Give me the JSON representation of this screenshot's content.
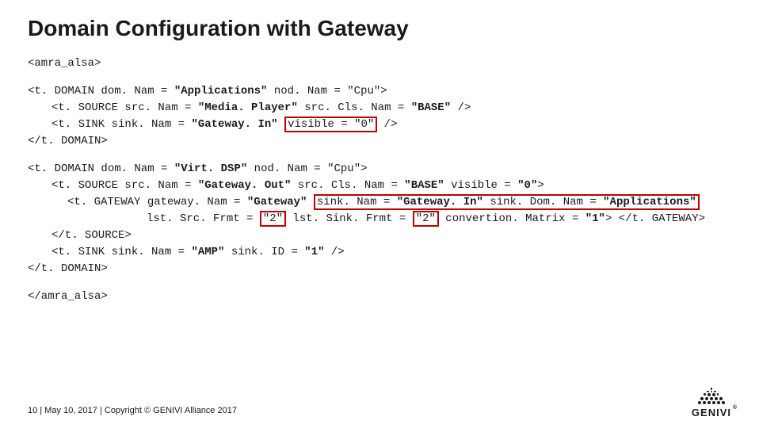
{
  "title": "Domain Configuration with Gateway",
  "code": {
    "open_tag": "<amra_alsa>",
    "block1": {
      "line1_pre": "<t. DOMAIN dom. Nam = ",
      "line1_bold1": "\"Applications\"",
      "line1_mid": " nod. Nam = \"Cpu\">",
      "line2_pre": "<t. SOURCE src. Nam = ",
      "line2_bold1": "\"Media. Player\"",
      "line2_mid": " src. Cls. Nam = ",
      "line2_bold2": "\"BASE\"",
      "line2_end": " />",
      "line3_pre": "<t. SINK sink. Nam = ",
      "line3_bold1": "\"Gateway. In\"",
      "line3_space": " ",
      "line3_boxed": "visible = \"0\"",
      "line3_end": " />",
      "line4": "</t. DOMAIN>"
    },
    "block2": {
      "line1_pre": "<t. DOMAIN dom. Nam = ",
      "line1_bold1": "\"Virt. DSP\"",
      "line1_end": " nod. Nam = \"Cpu\">",
      "line2_pre": "<t. SOURCE src. Nam = ",
      "line2_bold1": "\"Gateway. Out\"",
      "line2_mid1": " src. Cls. Nam = ",
      "line2_bold2": "\"BASE\"",
      "line2_mid2": " visible = ",
      "line2_bold3": "\"0\"",
      "line2_end": ">",
      "line3_pre": "<t. GATEWAY gateway. Nam = ",
      "line3_bold1": "\"Gateway\"",
      "line3_space": " ",
      "line3_box_pre": "sink. Nam = ",
      "line3_box_bold": "\"Gateway. In\"",
      "line3_box_mid": " sink. Dom. Nam = ",
      "line3_box_bold2": "\"Applications\"",
      "line4_pre": "lst. Src. Frmt = ",
      "line4_box1": "\"2\"",
      "line4_mid": " lst. Sink. Frmt = ",
      "line4_box2": "\"2\"",
      "line4_post": " convertion. Matrix = ",
      "line4_bold": "\"1\"",
      "line4_end": "> </t. GATEWAY>",
      "line5": "</t. SOURCE>",
      "line6_pre": "<t. SINK sink. Nam = ",
      "line6_bold1": "\"AMP\"",
      "line6_mid": " sink. ID = ",
      "line6_bold2": "\"1\"",
      "line6_end": " />",
      "line7": "</t. DOMAIN>"
    },
    "close_tag": "</amra_alsa>"
  },
  "footer": {
    "page": "10",
    "sep": " | ",
    "date": "May 10, 2017",
    "copyright": "Copyright © GENIVI Alliance 2017"
  },
  "logo_text": "GENIVI"
}
